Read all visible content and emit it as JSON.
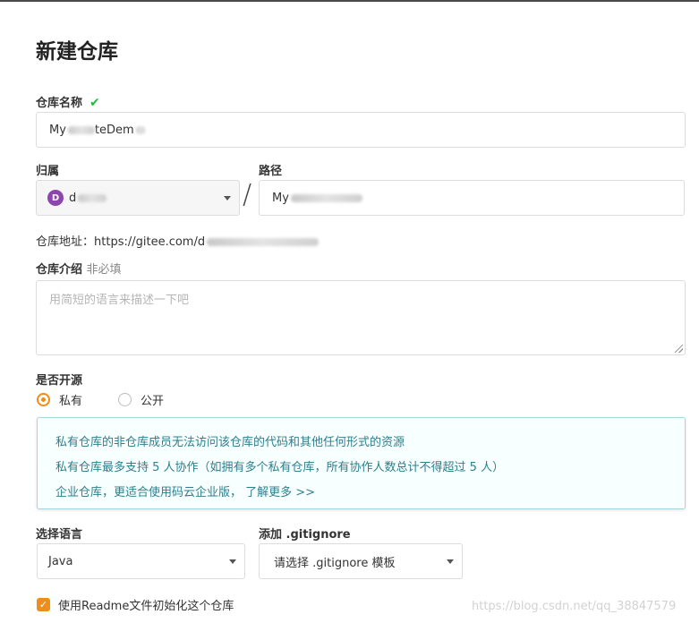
{
  "page_title": "新建仓库",
  "repo_name": {
    "label": "仓库名称",
    "value": "My",
    "value_tail": "teDem"
  },
  "owner": {
    "label": "归属",
    "avatar_letter": "D",
    "value": "d"
  },
  "path": {
    "label": "路径",
    "value": "My"
  },
  "repo_address": {
    "label": "仓库地址：",
    "value": "https://gitee.com/d"
  },
  "description": {
    "label": "仓库介绍",
    "optional": "非必填",
    "placeholder": "用简短的语言来描述一下吧"
  },
  "visibility": {
    "label": "是否开源",
    "options": [
      {
        "label": "私有",
        "selected": true
      },
      {
        "label": "公开",
        "selected": false
      }
    ]
  },
  "info_box": {
    "line1": "私有仓库的非仓库成员无法访问该仓库的代码和其他任何形式的资源",
    "line2": "私有仓库最多支持 5 人协作（如拥有多个私有仓库，所有协作人数总计不得超过 5 人）",
    "line3": "企业仓库，更适合使用码云企业版，",
    "line3_link": "了解更多 >>"
  },
  "language": {
    "label": "选择语言",
    "value": "Java"
  },
  "gitignore": {
    "label": "添加 .gitignore",
    "value": "请选择 .gitignore 模板"
  },
  "readme": {
    "label": "使用Readme文件初始化这个仓库",
    "checked": true
  },
  "watermark": "https://blog.csdn.net/qq_38847579",
  "colors": {
    "accent": "#f08c1c",
    "check": "#21ba45",
    "info_text": "#2c7f8e",
    "info_border": "#a9d5de"
  }
}
